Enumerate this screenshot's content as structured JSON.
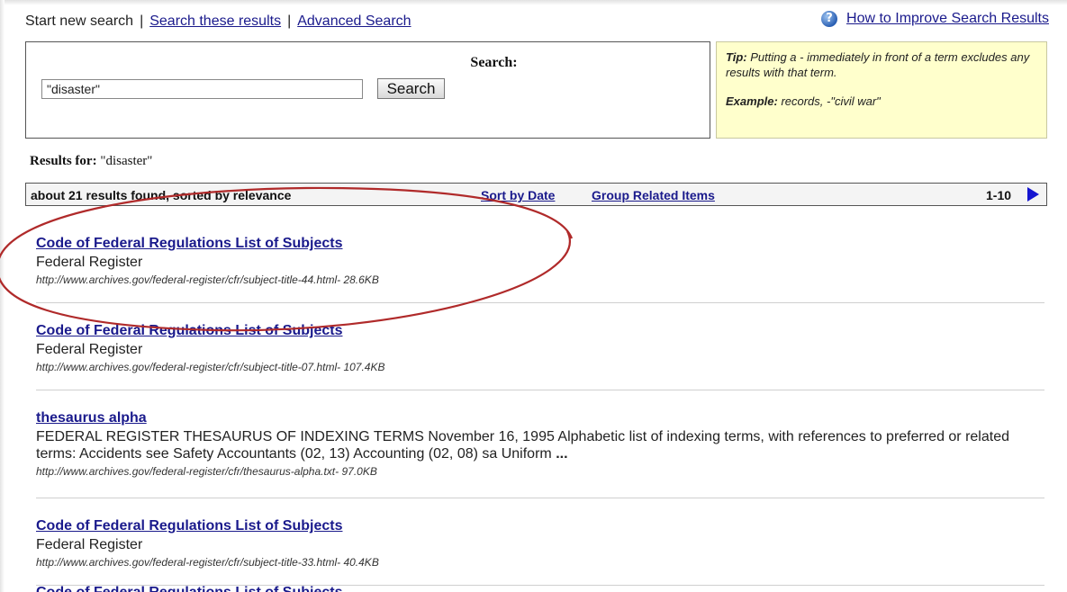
{
  "nav": {
    "start_new_search": "Start new search",
    "sep1": "|",
    "search_these_results": "Search these results",
    "sep2": "|",
    "advanced_search": "Advanced Search",
    "help_link": "How to Improve Search Results",
    "help_icon": "question-circle-icon"
  },
  "search": {
    "label": "Search:",
    "value": "\"disaster\"",
    "button_label": "Search"
  },
  "tip": {
    "heading": "Tip:",
    "text": "Putting a - immediately in front of a term excludes any results with that term.",
    "example_label": "Example:",
    "example_text": "records, -\"civil war\""
  },
  "results_for": {
    "label": "Results for:",
    "query": "\"disaster\""
  },
  "bar": {
    "count_text": "about 21 results found, sorted by relevance",
    "sort_by_date": "Sort by Date",
    "group_related": "Group Related Items",
    "range": "1-10",
    "next_icon": "next-page-arrow-icon"
  },
  "results": [
    {
      "title": "Code of Federal Regulations List of Subjects",
      "desc": "Federal Register",
      "url": "http://www.archives.gov/federal-register/cfr/subject-title-44.html- 28.6KB"
    },
    {
      "title": "Code of Federal Regulations List of Subjects",
      "desc": "Federal Register",
      "url": "http://www.archives.gov/federal-register/cfr/subject-title-07.html- 107.4KB"
    },
    {
      "title": "thesaurus alpha",
      "desc": "FEDERAL REGISTER THESAURUS OF INDEXING TERMS November 16, 1995 Alphabetic list of indexing terms, with references to preferred or related terms: Accidents see Safety Accountants (02, 13) Accounting (02, 08) sa Uniform",
      "desc_ellipsis": "...",
      "url": "http://www.archives.gov/federal-register/cfr/thesaurus-alpha.txt- 97.0KB"
    },
    {
      "title": "Code of Federal Regulations List of Subjects",
      "desc": "Federal Register",
      "url": "http://www.archives.gov/federal-register/cfr/subject-title-33.html- 40.4KB"
    },
    {
      "title": "Code of Federal Regulations List of Subjects"
    }
  ],
  "annotation": {
    "circle_color": "#b02a2a"
  }
}
